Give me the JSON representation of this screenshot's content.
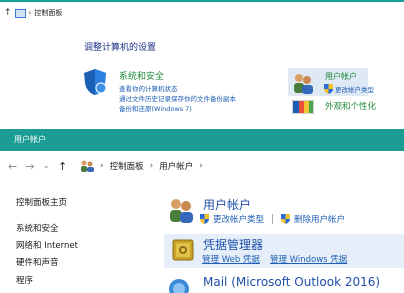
{
  "top_window": {
    "address": {
      "up": "↑",
      "path": "控制面板"
    },
    "heading": "调整计算机的设置",
    "system_security": {
      "title": "系统和安全",
      "links": [
        "查看你的计算机状态",
        "通过文件历史记录保存你的文件备份副本",
        "备份和还原(Windows 7)"
      ]
    },
    "user_accounts": {
      "title": "用户帐户",
      "link": "更改帐户类型"
    },
    "appearance": {
      "title": "外观和个性化"
    }
  },
  "bottom_window": {
    "title": "用户帐户",
    "nav": {
      "back": "←",
      "forward": "→",
      "dropdown": "⌄",
      "up": "↑"
    },
    "breadcrumb": [
      "控制面板",
      "用户帐户"
    ],
    "sidebar": [
      "控制面板主页",
      "系统和安全",
      "网络和 Internet",
      "硬件和声音",
      "程序"
    ],
    "user_accounts": {
      "title": "用户帐户",
      "links": [
        "更改帐户类型",
        "删除用户帐户"
      ]
    },
    "credential_manager": {
      "title": "凭据管理器",
      "links": [
        "管理 Web 凭据",
        "管理 Windows 凭据"
      ]
    },
    "mail": {
      "title": "Mail (Microsoft Outlook 2016)"
    }
  },
  "colors": {
    "accent": "#1b9c94",
    "link": "#1f5fb5",
    "category_green": "#218a3a",
    "title_blue": "#1d4fa8"
  }
}
